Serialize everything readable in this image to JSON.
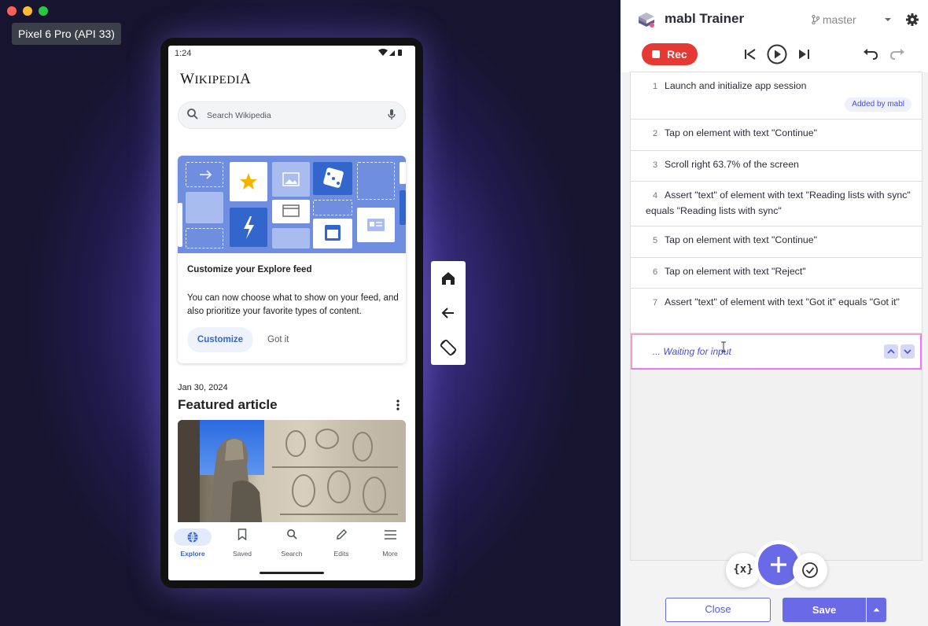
{
  "emulator": {
    "device_label": "Pixel 6 Pro (API 33)",
    "status_time": "1:24",
    "app": {
      "logo_text_parts": [
        "W",
        "IKIPEDI",
        "A"
      ],
      "search_placeholder": "Search Wikipedia",
      "explore_card": {
        "title": "Customize your Explore feed",
        "description": "You can now choose what to show on your feed, and also prioritize your favorite types of content.",
        "primary_button": "Customize",
        "secondary_button": "Got it"
      },
      "featured": {
        "date": "Jan 30, 2024",
        "title": "Featured article"
      },
      "nav": [
        {
          "label": "Explore",
          "icon": "globe-icon",
          "active": true
        },
        {
          "label": "Saved",
          "icon": "bookmark-icon",
          "active": false
        },
        {
          "label": "Search",
          "icon": "search-icon",
          "active": false
        },
        {
          "label": "Edits",
          "icon": "pencil-icon",
          "active": false
        },
        {
          "label": "More",
          "icon": "menu-icon",
          "active": false
        }
      ]
    },
    "device_controls": [
      "home-icon",
      "back-arrow-icon",
      "rotate-screen-icon"
    ]
  },
  "trainer": {
    "title": "mabl Trainer",
    "branch": "master",
    "record_label": "Rec",
    "steps": [
      {
        "num": "1",
        "text": "Launch and initialize app session",
        "badge": "Added by mabl"
      },
      {
        "num": "2",
        "text": "Tap on element with text \"Continue\""
      },
      {
        "num": "3",
        "text": "Scroll right 63.7% of the screen"
      },
      {
        "num": "4",
        "text": "Assert \"text\" of element with text \"Reading lists with sync\" equals \"Reading lists with sync\""
      },
      {
        "num": "5",
        "text": "Tap on element with text \"Continue\""
      },
      {
        "num": "6",
        "text": "Tap on element with text \"Reject\""
      },
      {
        "num": "7",
        "text": "Assert \"text\" of element with text \"Got it\" equals \"Got it\""
      }
    ],
    "waiting_text": "... Waiting for input",
    "variables_label": "{x}",
    "close_label": "Close",
    "save_label": "Save"
  },
  "colors": {
    "accent": "#6a6ae6",
    "record_red": "#e53935",
    "wiki_blue": "#3366cc"
  }
}
